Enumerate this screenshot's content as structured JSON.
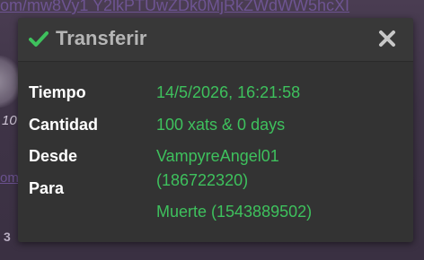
{
  "background": {
    "url_fragment_top": "om/mw8Vy1 Y2lkPTUwZDk0MjRkZWdWW5hcXI",
    "url_fragment_mid": "om",
    "italic_fragment": "10",
    "count_fragment": "3"
  },
  "dialog": {
    "title": "Transferir",
    "icons": {
      "title_icon": "check-icon",
      "close_icon": "close-icon"
    },
    "colors": {
      "accent_green": "#3ec15d",
      "header_bg": "#383838",
      "body_bg": "#333333"
    },
    "fields": {
      "time_label": "Tiempo",
      "time_value": "14/5/2026, 16:21:58",
      "amount_label": "Cantidad",
      "amount_value": "100 xats & 0 days",
      "from_label": "Desde",
      "from_value_line1": "VampyreAngel01",
      "from_value_line2": "(186722320)",
      "to_label": "Para",
      "to_value": "Muerte (1543889502)"
    }
  }
}
